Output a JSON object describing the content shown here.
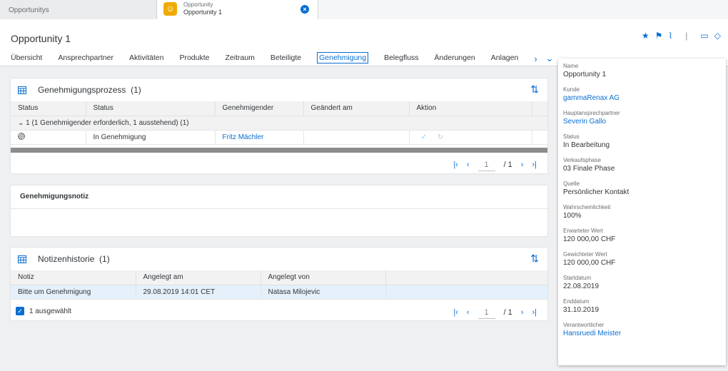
{
  "tabbar": {
    "tab1_label": "Opportunitys",
    "tab2_type": "Opportunity",
    "tab2_name": "Opportunity 1"
  },
  "header": {
    "title": "Opportunity 1",
    "tabs": [
      "Übersicht",
      "Ansprechpartner",
      "Aktivitäten",
      "Produkte",
      "Zeitraum",
      "Beteiligte",
      "Genehmigung",
      "Belegfluss",
      "Änderungen",
      "Anlagen"
    ],
    "active_tab": "Genehmigung"
  },
  "approval": {
    "title": "Genehmigungsprozess",
    "count": "(1)",
    "columns": [
      "Status",
      "Status",
      "Genehmigender",
      "Geändert am",
      "Aktion"
    ],
    "group_label": "1 (1 Genehmigender erforderlich, 1 ausstehend) (1)",
    "row": {
      "status": "In Genehmigung",
      "approver": "Fritz Mächler",
      "changed": ""
    },
    "pager": {
      "page": "1",
      "total": "/ 1"
    }
  },
  "note": {
    "title": "Genehmigungsnotiz"
  },
  "history": {
    "title": "Notizenhistorie",
    "count": "(1)",
    "columns": [
      "Notiz",
      "Angelegt am",
      "Angelegt von"
    ],
    "row": {
      "note": "Bitte um Genehmigung",
      "created": "29.08.2019 14:01 CET",
      "by": "Natasa Milojevic"
    },
    "selected": "1 ausgewählt",
    "pager": {
      "page": "1",
      "total": "/ 1"
    }
  },
  "side": {
    "fields": [
      {
        "label": "Name",
        "value": "Opportunity 1",
        "link": false
      },
      {
        "label": "Kunde",
        "value": "gammaRenax AG",
        "link": true
      },
      {
        "label": "Hauptansprechpartner",
        "value": "Severin Gallo",
        "link": true
      },
      {
        "label": "Status",
        "value": "In Bearbeitung",
        "link": false
      },
      {
        "label": "Verkaufsphase",
        "value": "03 Finale Phase",
        "link": false
      },
      {
        "label": "Quelle",
        "value": "Persönlicher Kontakt",
        "link": false
      },
      {
        "label": "Wahrscheinlichkeit",
        "value": "100%",
        "link": false
      },
      {
        "label": "Erwarteter Wert",
        "value": "120 000,00 CHF",
        "link": false
      },
      {
        "label": "Gewichteter Wert",
        "value": "120 000,00 CHF",
        "link": false
      },
      {
        "label": "Startdatum",
        "value": "22.08.2019",
        "link": false
      },
      {
        "label": "Enddatum",
        "value": "31.10.2019",
        "link": false
      },
      {
        "label": "Verantwortlicher",
        "value": "Hansruedi Meister",
        "link": true
      }
    ]
  }
}
